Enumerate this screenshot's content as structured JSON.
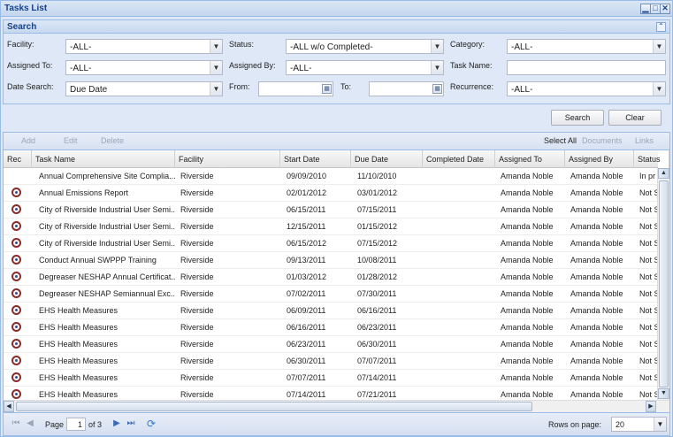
{
  "window": {
    "title": "Tasks List",
    "controls": [
      "▁",
      "□",
      "✕"
    ]
  },
  "search": {
    "title": "Search",
    "collapse_glyph": "⌃",
    "facility": {
      "label": "Facility:",
      "value": "-ALL-"
    },
    "status": {
      "label": "Status:",
      "value": "-ALL w/o Completed-"
    },
    "category": {
      "label": "Category:",
      "value": "-ALL-"
    },
    "assigned_to": {
      "label": "Assigned To:",
      "value": "-ALL-"
    },
    "assigned_by": {
      "label": "Assigned By:",
      "value": "-ALL-"
    },
    "task_name": {
      "label": "Task Name:",
      "value": ""
    },
    "date_search": {
      "label": "Date Search:",
      "value": "Due Date"
    },
    "from": {
      "label": "From:",
      "value": ""
    },
    "to": {
      "label": "To:",
      "value": ""
    },
    "recurrence": {
      "label": "Recurrence:",
      "value": "-ALL-"
    },
    "search_button": "Search",
    "clear_button": "Clear"
  },
  "toolbar": {
    "add": "Add",
    "edit": "Edit",
    "delete": "Delete",
    "select_all": "Select All",
    "documents": "Documents",
    "links": "Links"
  },
  "grid": {
    "columns": [
      "Rec",
      "Task Name",
      "Facility",
      "Start Date",
      "Due Date",
      "Completed Date",
      "Assigned To",
      "Assigned By",
      "Status"
    ],
    "rows": [
      {
        "rec": false,
        "task": "Annual Comprehensive Site Complia...",
        "facility": "Riverside",
        "start": "09/09/2010",
        "due": "11/10/2010",
        "completed": "",
        "to": "Amanda Noble",
        "by": "Amanda Noble",
        "status": "In pr"
      },
      {
        "rec": true,
        "task": "Annual Emissions Report",
        "facility": "Riverside",
        "start": "02/01/2012",
        "due": "03/01/2012",
        "completed": "",
        "to": "Amanda Noble",
        "by": "Amanda Noble",
        "status": "Not S"
      },
      {
        "rec": true,
        "task": "City of Riverside Industrial User Semi...",
        "facility": "Riverside",
        "start": "06/15/2011",
        "due": "07/15/2011",
        "completed": "",
        "to": "Amanda Noble",
        "by": "Amanda Noble",
        "status": "Not S"
      },
      {
        "rec": true,
        "task": "City of Riverside Industrial User Semi...",
        "facility": "Riverside",
        "start": "12/15/2011",
        "due": "01/15/2012",
        "completed": "",
        "to": "Amanda Noble",
        "by": "Amanda Noble",
        "status": "Not S"
      },
      {
        "rec": true,
        "task": "City of Riverside Industrial User Semi...",
        "facility": "Riverside",
        "start": "06/15/2012",
        "due": "07/15/2012",
        "completed": "",
        "to": "Amanda Noble",
        "by": "Amanda Noble",
        "status": "Not S"
      },
      {
        "rec": true,
        "task": "Conduct Annual SWPPP Training",
        "facility": "Riverside",
        "start": "09/13/2011",
        "due": "10/08/2011",
        "completed": "",
        "to": "Amanda Noble",
        "by": "Amanda Noble",
        "status": "Not S"
      },
      {
        "rec": true,
        "task": "Degreaser NESHAP Annual Certificat...",
        "facility": "Riverside",
        "start": "01/03/2012",
        "due": "01/28/2012",
        "completed": "",
        "to": "Amanda Noble",
        "by": "Amanda Noble",
        "status": "Not S"
      },
      {
        "rec": true,
        "task": "Degreaser NESHAP Semiannual Exc...",
        "facility": "Riverside",
        "start": "07/02/2011",
        "due": "07/30/2011",
        "completed": "",
        "to": "Amanda Noble",
        "by": "Amanda Noble",
        "status": "Not S"
      },
      {
        "rec": true,
        "task": "EHS Health Measures",
        "facility": "Riverside",
        "start": "06/09/2011",
        "due": "06/16/2011",
        "completed": "",
        "to": "Amanda Noble",
        "by": "Amanda Noble",
        "status": "Not S"
      },
      {
        "rec": true,
        "task": "EHS Health Measures",
        "facility": "Riverside",
        "start": "06/16/2011",
        "due": "06/23/2011",
        "completed": "",
        "to": "Amanda Noble",
        "by": "Amanda Noble",
        "status": "Not S"
      },
      {
        "rec": true,
        "task": "EHS Health Measures",
        "facility": "Riverside",
        "start": "06/23/2011",
        "due": "06/30/2011",
        "completed": "",
        "to": "Amanda Noble",
        "by": "Amanda Noble",
        "status": "Not S"
      },
      {
        "rec": true,
        "task": "EHS Health Measures",
        "facility": "Riverside",
        "start": "06/30/2011",
        "due": "07/07/2011",
        "completed": "",
        "to": "Amanda Noble",
        "by": "Amanda Noble",
        "status": "Not S"
      },
      {
        "rec": true,
        "task": "EHS Health Measures",
        "facility": "Riverside",
        "start": "07/07/2011",
        "due": "07/14/2011",
        "completed": "",
        "to": "Amanda Noble",
        "by": "Amanda Noble",
        "status": "Not S"
      },
      {
        "rec": true,
        "task": "EHS Health Measures",
        "facility": "Riverside",
        "start": "07/14/2011",
        "due": "07/21/2011",
        "completed": "",
        "to": "Amanda Noble",
        "by": "Amanda Noble",
        "status": "Not S"
      }
    ]
  },
  "pager": {
    "page_label": "Page",
    "page_value": "1",
    "of_label": "of 3",
    "rows_label": "Rows on page:",
    "rows_value": "20"
  },
  "colors": {
    "accent": "#15428b",
    "border": "#99bbe8",
    "panel_bg": "#dfe8f6"
  }
}
